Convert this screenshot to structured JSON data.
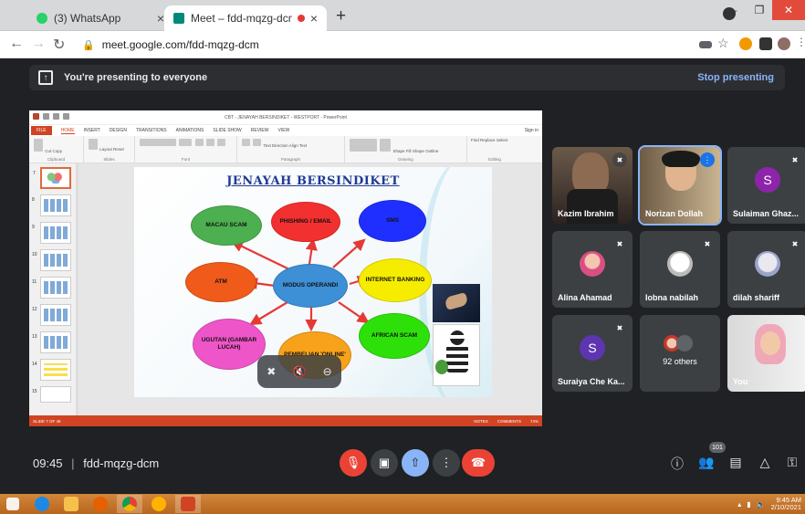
{
  "browser": {
    "tabs": [
      {
        "title": "(3) WhatsApp",
        "favicon_color": "#25d366"
      },
      {
        "title": "Meet – fdd-mqzg-dcm",
        "favicon_color": "#00897b"
      }
    ],
    "new_tab_label": "+",
    "close_glyph": "×",
    "url": "meet.google.com/fdd-mqzg-dcm",
    "back_icon": "arrow-left-icon",
    "forward_icon": "arrow-right-icon",
    "reload_icon": "reload-icon"
  },
  "meet": {
    "banner_text": "You're presenting to everyone",
    "stop_presenting_label": "Stop presenting",
    "meeting_time": "09:45",
    "meeting_code": "fdd-mqzg-dcm",
    "people_count": "101",
    "accent_color": "#8ab4f8",
    "end_call_color": "#ea4335"
  },
  "ppt": {
    "window_title": "CBT - JENAYAH BERSINDIKET - WESTPORT - PowerPoint",
    "tabs": [
      "FILE",
      "HOME",
      "INSERT",
      "DESIGN",
      "TRANSITIONS",
      "ANIMATIONS",
      "SLIDE SHOW",
      "REVIEW",
      "VIEW"
    ],
    "sign_in": "Sign in",
    "ribbon_groups": [
      "Clipboard",
      "Slides",
      "Font",
      "Paragraph",
      "Drawing",
      "Editing"
    ],
    "ribbon_items": {
      "cut": "Cut",
      "copy": "Copy",
      "paste": "Paste",
      "format_painter": "Format Painter",
      "new_slide": "New Slide",
      "layout": "Layout",
      "reset": "Reset",
      "section": "Section",
      "text_direction": "Text Direction",
      "align_text": "Align Text",
      "convert_smartart": "Convert to SmartArt",
      "arrange": "Arrange",
      "quick_styles": "Quick Styles",
      "shape_fill": "Shape Fill",
      "shape_outline": "Shape Outline",
      "shape_effects": "Shape Effects",
      "find": "Find",
      "replace": "Replace",
      "select": "Select"
    },
    "slide_numbers": [
      "7",
      "8",
      "9",
      "10",
      "11",
      "12",
      "13",
      "14",
      "15"
    ],
    "status_left": "SLIDE 7 OF 46",
    "status_notes": "NOTES",
    "status_comments": "COMMENTS",
    "zoom": "74%"
  },
  "slide": {
    "title": "JENAYAH BERSINDIKET",
    "center": "MODUS OPERANDI",
    "nodes": [
      {
        "label": "MACAU SCAM",
        "color": "#4caf50"
      },
      {
        "label": "PHISHING / EMAIL",
        "color": "#f33030"
      },
      {
        "label": "SMS",
        "color": "#1f2fff"
      },
      {
        "label": "ATM",
        "color": "#f05a1a"
      },
      {
        "label": "INTERNET BANKING",
        "color": "#f5ec00"
      },
      {
        "label": "UGUTAN (GAMBAR LUCAH)",
        "color": "#ee55c8"
      },
      {
        "label": "PEMBELIAN 'ONLINE'",
        "color": "#f7a21a"
      },
      {
        "label": "AFRICAN SCAM",
        "color": "#2ee00a"
      }
    ],
    "center_color": "#3d8fd6",
    "arrow_color": "#e53935"
  },
  "participants": [
    {
      "name": "Kazim Ibrahim",
      "type": "video",
      "muted": true
    },
    {
      "name": "Norizan Dollah",
      "type": "video",
      "muted": false,
      "speaking": true
    },
    {
      "name": "Sulaiman Ghaz...",
      "type": "initial",
      "initial": "S",
      "color": "#8e24aa",
      "muted": true
    },
    {
      "name": "Alina Ahamad",
      "type": "photo",
      "muted": true
    },
    {
      "name": "Iobna nabilah",
      "type": "photo",
      "muted": true
    },
    {
      "name": "dilah shariff",
      "type": "photo",
      "muted": true
    },
    {
      "name": "Suraiya Che Ka...",
      "type": "initial",
      "initial": "S",
      "color": "#5e35b1",
      "muted": true
    },
    {
      "name": "92 others",
      "type": "group",
      "muted": false
    },
    {
      "name": "You",
      "type": "video",
      "muted": true
    }
  ],
  "taskbar": {
    "apps": [
      "start-orb",
      "internet-explorer",
      "file-explorer",
      "firefox",
      "chrome",
      "media-player",
      "powerpoint"
    ],
    "time": "9:45 AM",
    "date": "2/10/2021"
  }
}
